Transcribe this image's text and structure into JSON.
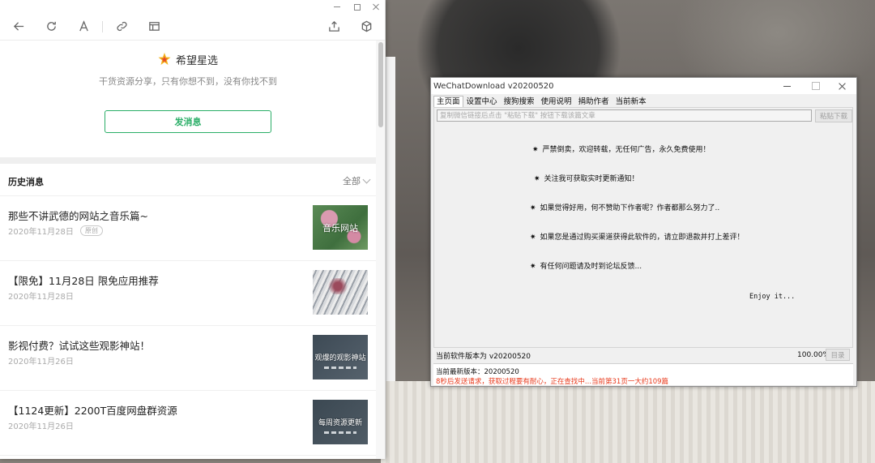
{
  "wechat_reader": {
    "brand_name": "希望星选",
    "slogan": "干货资源分享，只有你想不到，没有你找不到",
    "send_button": "发消息",
    "history_title": "历史消息",
    "history_filter": "全部",
    "articles": [
      {
        "title": "那些不讲武德的网站之音乐篇~",
        "date": "2020年11月28日",
        "badge": "原创",
        "thumb_text": "音乐网站"
      },
      {
        "title": "【限免】11月28日 限免应用推荐",
        "date": "2020年11月28日",
        "badge": "",
        "thumb_text": ""
      },
      {
        "title": "影视付费？试试这些观影神站！",
        "date": "2020年11月26日",
        "badge": "",
        "thumb_text": "观爆的观影神站"
      },
      {
        "title": "【1124更新】2200T百度网盘群资源",
        "date": "2020年11月26日",
        "badge": "",
        "thumb_text": "每周资源更新"
      }
    ]
  },
  "downloader": {
    "window_title": "WeChatDownload v20200520",
    "tabs": [
      "主页面",
      "设置中心",
      "搜狗搜索",
      "使用说明",
      "捐助作者",
      "当前新本"
    ],
    "url_placeholder": "复制微信链接后点击 \"粘贴下载\" 按钮下载该篇文章",
    "paste_button": "粘贴下载",
    "notices": [
      "严禁倒卖，欢迎转载，无任何广告，永久免费使用！",
      "关注我可获取实时更新通知！",
      "如果觉得好用，何不赞助下作者呢？作者都那么努力了..",
      "如果您是通过购买渠道获得此软件的，请立即退款并打上差评！",
      "有任何问题请及时到论坛反馈..."
    ],
    "star_glyph": "✷",
    "enjoy_text": "Enjoy it...",
    "version_text": "当前软件版本为 v20200520",
    "percent": "100.00%",
    "dir_button": "目录",
    "latest_text": "当前最新版本：20200520",
    "progress_text": "8秒后发送请求，获取过程要有耐心，正在查找中...当前第31页一大约109篇"
  },
  "colors": {
    "wechat_green": "#2aae67",
    "status_red": "#e8391b"
  }
}
